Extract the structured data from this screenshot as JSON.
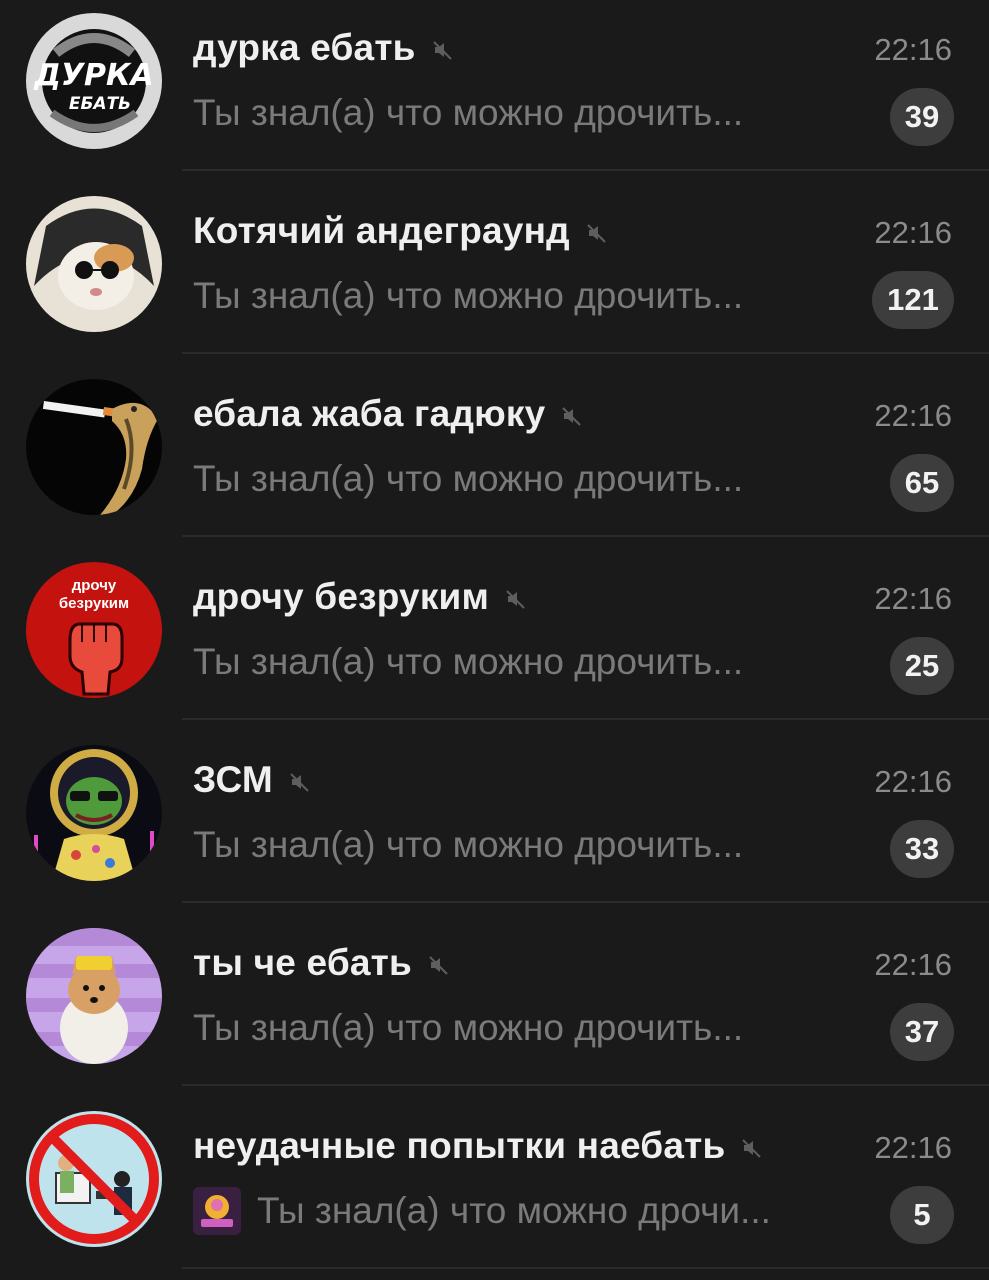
{
  "chats": [
    {
      "title": "дурка ебать",
      "time": "22:16",
      "preview": "Ты знал(а) что можно дрочить...",
      "unread": "39",
      "muted": true,
      "avatar": "durka-logo-avatar",
      "avatar_text": [
        "ДУРКА",
        "ЕБАТЬ"
      ]
    },
    {
      "title": "Котячий андеграунд",
      "time": "22:16",
      "preview": "Ты знал(а) что можно дрочить...",
      "unread": "121",
      "muted": true,
      "avatar": "cat-with-sunglasses-avatar"
    },
    {
      "title": "ебала жаба гадюку",
      "time": "22:16",
      "preview": "Ты знал(а) что можно дрочить...",
      "unread": "65",
      "muted": true,
      "avatar": "snake-smoking-avatar"
    },
    {
      "title": "дрочу безруким",
      "time": "22:16",
      "preview": "Ты знал(а) что можно дрочить...",
      "unread": "25",
      "muted": true,
      "avatar": "red-fist-avatar",
      "avatar_text": [
        "дрочу",
        "безруким"
      ]
    },
    {
      "title": "ЗСМ",
      "time": "22:16",
      "preview": "Ты знал(а) что можно дрочить...",
      "unread": "33",
      "muted": true,
      "avatar": "pepe-frog-avatar"
    },
    {
      "title": "ты че ебать",
      "time": "22:16",
      "preview": "Ты знал(а) что можно дрочить...",
      "unread": "37",
      "muted": true,
      "avatar": "shiba-dog-avatar"
    },
    {
      "title": "неудачные попытки наебать",
      "time": "22:16",
      "preview": "Ты знал(а) что можно дрочи...",
      "unread": "5",
      "muted": true,
      "avatar": "prohibited-sign-avatar",
      "preview_thumb": "adult-thumbnail"
    }
  ],
  "colors": {
    "background": "#1a1a1a",
    "title": "#efefef",
    "time": "#8b8b8b",
    "preview": "#7a7a7a",
    "badge": "#3d3d3d",
    "divider": "#2b2b2b"
  }
}
